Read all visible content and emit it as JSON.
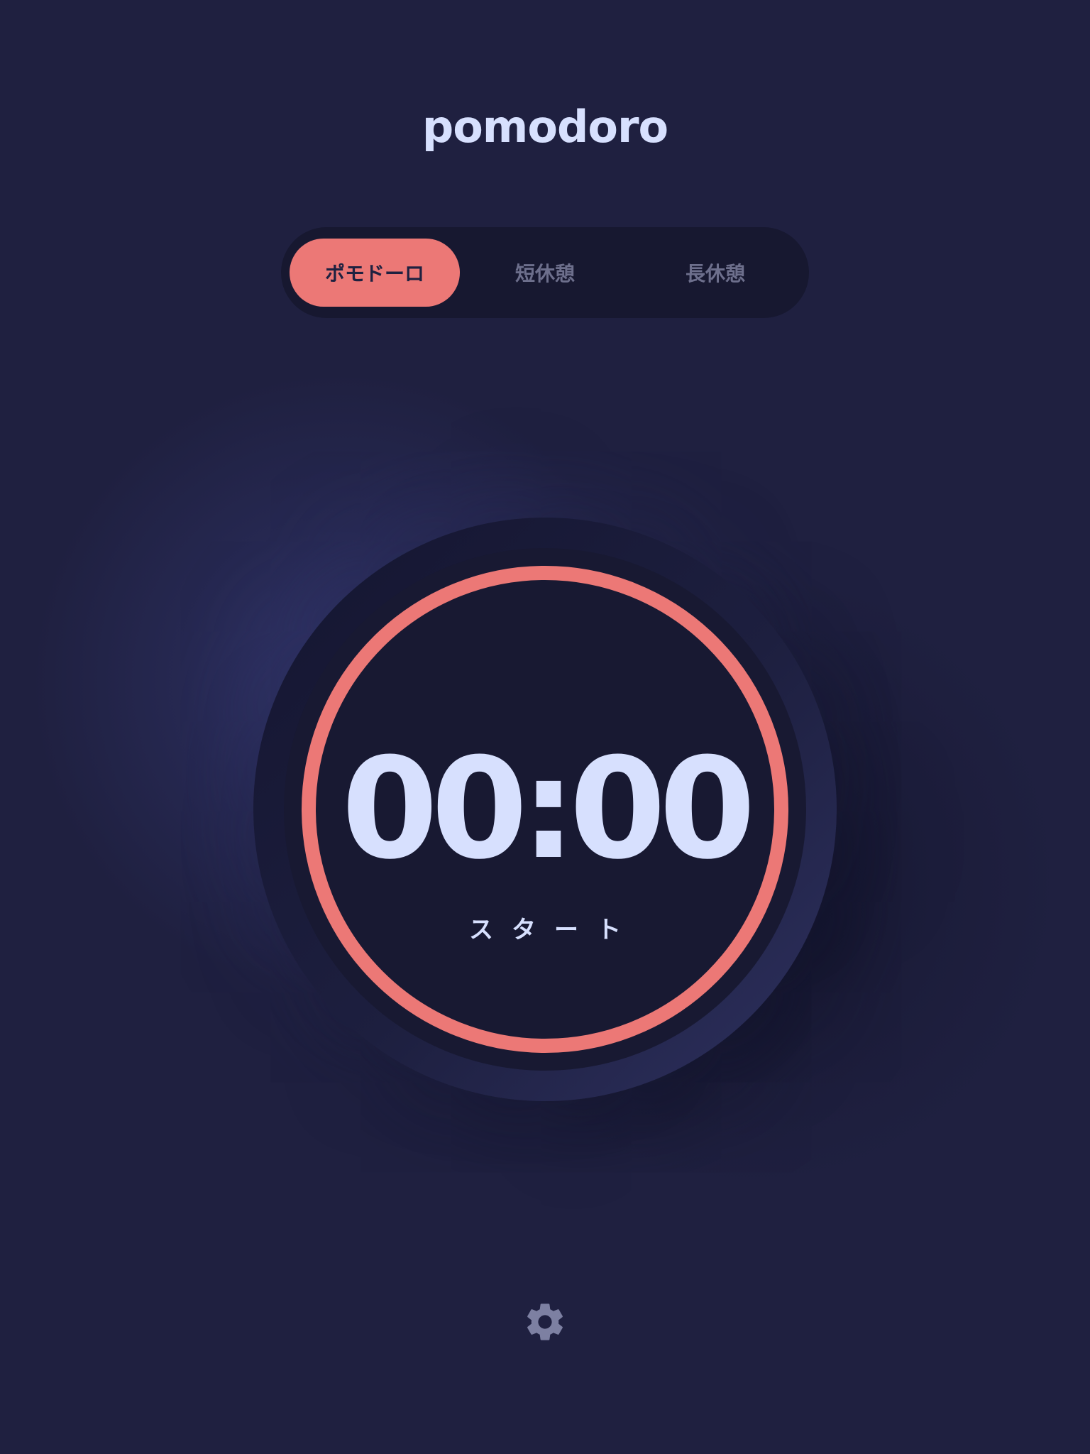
{
  "app": {
    "title": "pomodoro"
  },
  "tabs": [
    {
      "label": "ポモドーロ",
      "active": true
    },
    {
      "label": "短休憩",
      "active": false
    },
    {
      "label": "長休憩",
      "active": false
    }
  ],
  "timer": {
    "time": "00:00",
    "action_label": "スタート",
    "progress": 1.0
  },
  "settings": {
    "icon": "gear-icon"
  },
  "colors": {
    "accent": "#ec7876",
    "background": "#1f2040",
    "text": "#d7e0fe",
    "muted": "#6d6f8c",
    "icon": "#7d80a2"
  }
}
